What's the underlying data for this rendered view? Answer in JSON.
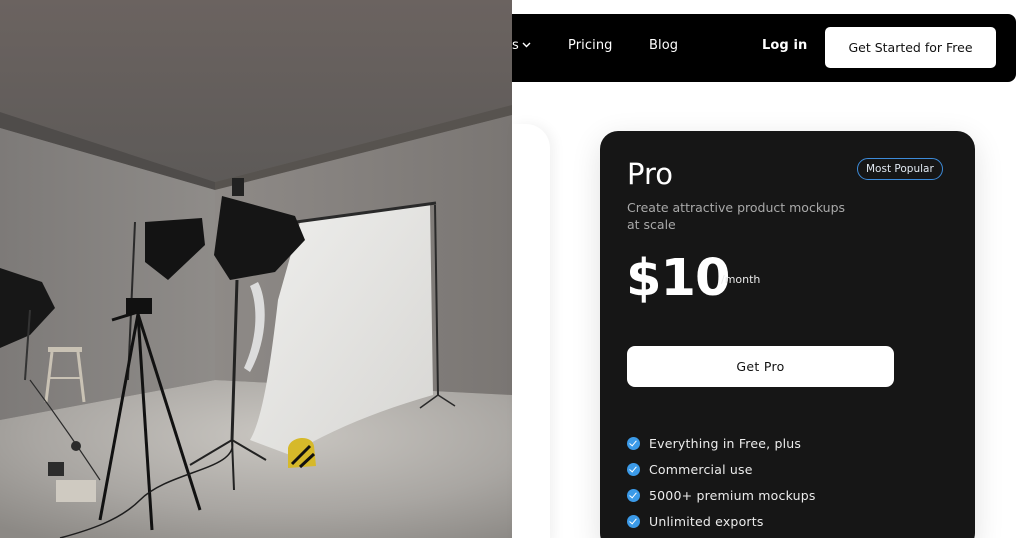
{
  "nav": {
    "partial_label": "s",
    "pricing": "Pricing",
    "blog": "Blog",
    "login": "Log in",
    "cta": "Get Started for Free"
  },
  "pro_plan": {
    "title": "Pro",
    "badge": "Most Popular",
    "description": "Create attractive product mockups at scale",
    "price": "$10",
    "period": "/month",
    "button": "Get Pro",
    "features": [
      "Everything in Free, plus",
      "Commercial use",
      "5000+ premium mockups",
      "Unlimited exports"
    ]
  },
  "icons": {
    "dropdown": "chevron-down-icon",
    "feature_check": "check-circle-icon"
  },
  "colors": {
    "nav_bg": "#000000",
    "card_bg": "#161616",
    "accent": "#3b9ae8",
    "badge_border": "#3d8bd9"
  }
}
